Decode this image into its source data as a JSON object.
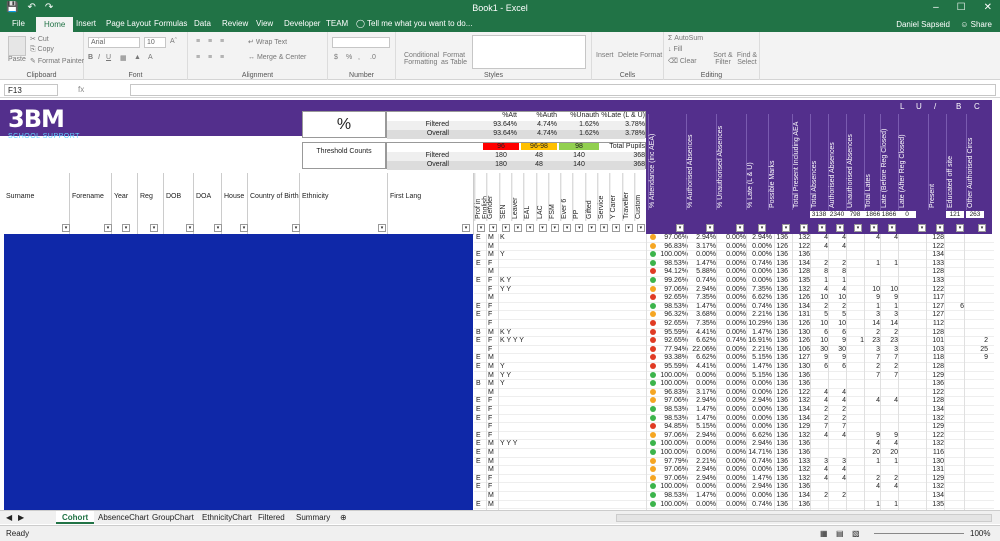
{
  "window": {
    "title": "Book1 - Excel",
    "user": "Daniel Sapseid",
    "share": "Share"
  },
  "tabs": [
    "File",
    "Home",
    "Insert",
    "Page Layout",
    "Formulas",
    "Data",
    "Review",
    "View",
    "Developer",
    "TEAM"
  ],
  "tell_me": "Tell me what you want to do...",
  "ribbon": {
    "clipboard": {
      "label": "Clipboard",
      "paste": "Paste",
      "cut": "Cut",
      "copy": "Copy",
      "format_painter": "Format Painter"
    },
    "font": {
      "label": "Font",
      "name": "Arial",
      "size": "10"
    },
    "alignment": {
      "label": "Alignment",
      "wrap": "Wrap Text",
      "merge": "Merge & Center"
    },
    "number": {
      "label": "Number"
    },
    "styles": {
      "label": "Styles",
      "conditional": "Conditional Formatting",
      "format_as_table": "Format as Table"
    },
    "cells": {
      "label": "Cells",
      "insert": "Insert",
      "delete": "Delete",
      "format": "Format"
    },
    "editing": {
      "label": "Editing",
      "autosum": "AutoSum",
      "fill": "Fill",
      "clear": "Clear",
      "sort": "Sort & Filter",
      "find": "Find & Select"
    }
  },
  "formula_bar": {
    "name_box": "F13",
    "fx": "fx"
  },
  "sheet": {
    "logo_big": "3BM",
    "logo_small": "SCHOOL SUPPORT",
    "pct_symbol": "%",
    "stats_headers": [
      "%Att",
      "%Auth",
      "%Unauth",
      "%Late (L & U)"
    ],
    "stats_filtered_label": "Filtered",
    "stats_overall_label": "Overall",
    "stats_filtered": [
      "93.64%",
      "4.74%",
      "1.62%",
      "3.78%"
    ],
    "stats_overall": [
      "93.64%",
      "4.74%",
      "1.62%",
      "3.78%"
    ],
    "threshold_label": "Threshold Counts",
    "threshold_headers": [
      "96",
      "96-98",
      "98",
      "Total Pupils"
    ],
    "threshold_colors": [
      "#ff0000",
      "#ffc000",
      "#92d050",
      "#ffffff"
    ],
    "threshold_filtered": [
      "180",
      "48",
      "140",
      "368"
    ],
    "threshold_overall": [
      "180",
      "48",
      "140",
      "368"
    ],
    "col_letters": [
      "L",
      "U",
      "/",
      "B",
      "C"
    ],
    "left_headers": [
      "Surname",
      "Forename",
      "Year",
      "Reg",
      "DOB",
      "DOA",
      "House",
      "Country of Birth",
      "Ethnicity",
      "First Lang"
    ],
    "flag_headers": [
      "Prof in English",
      "Gender",
      "SEN",
      "Leaver",
      "EAL",
      "LAC",
      "FSM",
      "Ever 6",
      "PP",
      "Gifted",
      "Service",
      "Y Carer",
      "Traveller",
      "Custom"
    ],
    "metric_headers": [
      "% Attendance (inc AEA)",
      "% Authorised Absences",
      "% Unauthorised Absences",
      "% Late (L & U)",
      "Possible Marks",
      "Total Present Including AEA",
      "Total Absences",
      "Authorised Absences",
      "Unauthorised Absences",
      "Total Lates",
      "Late (Before Reg Closed)",
      "Late (After Reg Closed)",
      "Present",
      "Educated off site",
      "Other Authorised Circs"
    ],
    "totals": {
      "total_absences": "3138",
      "auth": "2340",
      "unauth": "798",
      "total_lates": "1866",
      "late_before": "1866",
      "late_after": "0",
      "edu_off": "121",
      "other_auth": "263"
    },
    "rows": [
      {
        "p": "E",
        "g": "M",
        "f": "K",
        "c": "orange",
        "att": "97.06%",
        "auth": "2.94%",
        "un": "0.00%",
        "late": "2.94%",
        "pm": "136",
        "tp": "132",
        "ta": "4",
        "aa": "4",
        "ua": "",
        "tl": "4",
        "lb": "4",
        "la": "",
        "pr": "128",
        "eo": "",
        "oa": ""
      },
      {
        "p": "",
        "g": "M",
        "f": "",
        "c": "orange",
        "att": "96.83%",
        "auth": "3.17%",
        "un": "0.00%",
        "late": "0.00%",
        "pm": "126",
        "tp": "122",
        "ta": "4",
        "aa": "4",
        "ua": "",
        "tl": "",
        "lb": "",
        "la": "",
        "pr": "122",
        "eo": "",
        "oa": ""
      },
      {
        "p": "E",
        "g": "M",
        "f": "Y",
        "c": "green",
        "att": "100.00%",
        "auth": "0.00%",
        "un": "0.00%",
        "late": "0.00%",
        "pm": "136",
        "tp": "136",
        "ta": "",
        "aa": "",
        "ua": "",
        "tl": "",
        "lb": "",
        "la": "",
        "pr": "134",
        "eo": "",
        "oa": ""
      },
      {
        "p": "E",
        "g": "F",
        "f": "",
        "c": "green",
        "att": "98.53%",
        "auth": "1.47%",
        "un": "0.00%",
        "late": "0.74%",
        "pm": "136",
        "tp": "134",
        "ta": "2",
        "aa": "2",
        "ua": "",
        "tl": "1",
        "lb": "1",
        "la": "",
        "pr": "133",
        "eo": "",
        "oa": ""
      },
      {
        "p": "",
        "g": "M",
        "f": "",
        "c": "red",
        "att": "94.12%",
        "auth": "5.88%",
        "un": "0.00%",
        "late": "0.00%",
        "pm": "136",
        "tp": "128",
        "ta": "8",
        "aa": "8",
        "ua": "",
        "tl": "",
        "lb": "",
        "la": "",
        "pr": "128",
        "eo": "",
        "oa": ""
      },
      {
        "p": "E",
        "g": "F",
        "f": "K Y",
        "c": "green",
        "att": "99.26%",
        "auth": "0.74%",
        "un": "0.00%",
        "late": "0.00%",
        "pm": "136",
        "tp": "135",
        "ta": "1",
        "aa": "1",
        "ua": "",
        "tl": "",
        "lb": "",
        "la": "",
        "pr": "133",
        "eo": "",
        "oa": ""
      },
      {
        "p": "",
        "g": "F",
        "f": "Y Y",
        "c": "orange",
        "att": "97.06%",
        "auth": "2.94%",
        "un": "0.00%",
        "late": "7.35%",
        "pm": "136",
        "tp": "132",
        "ta": "4",
        "aa": "4",
        "ua": "",
        "tl": "10",
        "lb": "10",
        "la": "",
        "pr": "122",
        "eo": "",
        "oa": ""
      },
      {
        "p": "",
        "g": "M",
        "f": "",
        "c": "red",
        "att": "92.65%",
        "auth": "7.35%",
        "un": "0.00%",
        "late": "6.62%",
        "pm": "136",
        "tp": "126",
        "ta": "10",
        "aa": "10",
        "ua": "",
        "tl": "9",
        "lb": "9",
        "la": "",
        "pr": "117",
        "eo": "",
        "oa": ""
      },
      {
        "p": "E",
        "g": "F",
        "f": "",
        "c": "green",
        "att": "98.53%",
        "auth": "1.47%",
        "un": "0.00%",
        "late": "0.74%",
        "pm": "136",
        "tp": "134",
        "ta": "2",
        "aa": "2",
        "ua": "",
        "tl": "1",
        "lb": "1",
        "la": "",
        "pr": "127",
        "eo": "6",
        "oa": ""
      },
      {
        "p": "E",
        "g": "F",
        "f": "",
        "c": "orange",
        "att": "96.32%",
        "auth": "3.68%",
        "un": "0.00%",
        "late": "2.21%",
        "pm": "136",
        "tp": "131",
        "ta": "5",
        "aa": "5",
        "ua": "",
        "tl": "3",
        "lb": "3",
        "la": "",
        "pr": "127",
        "eo": "",
        "oa": ""
      },
      {
        "p": "",
        "g": "F",
        "f": "",
        "c": "red",
        "att": "92.65%",
        "auth": "7.35%",
        "un": "0.00%",
        "late": "10.29%",
        "pm": "136",
        "tp": "126",
        "ta": "10",
        "aa": "10",
        "ua": "",
        "tl": "14",
        "lb": "14",
        "la": "",
        "pr": "112",
        "eo": "",
        "oa": ""
      },
      {
        "p": "B",
        "g": "M",
        "f": "K Y",
        "c": "red",
        "att": "95.59%",
        "auth": "4.41%",
        "un": "0.00%",
        "late": "1.47%",
        "pm": "136",
        "tp": "130",
        "ta": "6",
        "aa": "6",
        "ua": "",
        "tl": "2",
        "lb": "2",
        "la": "",
        "pr": "128",
        "eo": "",
        "oa": ""
      },
      {
        "p": "E",
        "g": "F",
        "f": "K Y Y Y",
        "c": "red",
        "att": "92.65%",
        "auth": "6.62%",
        "un": "0.74%",
        "late": "16.91%",
        "pm": "136",
        "tp": "126",
        "ta": "10",
        "aa": "9",
        "ua": "1",
        "tl": "23",
        "lb": "23",
        "la": "",
        "pr": "101",
        "eo": "",
        "oa": "2"
      },
      {
        "p": "",
        "g": "F",
        "f": "",
        "c": "red",
        "att": "77.94%",
        "auth": "22.06%",
        "un": "0.00%",
        "late": "2.21%",
        "pm": "136",
        "tp": "106",
        "ta": "30",
        "aa": "30",
        "ua": "",
        "tl": "3",
        "lb": "3",
        "la": "",
        "pr": "103",
        "eo": "",
        "oa": "25"
      },
      {
        "p": "E",
        "g": "M",
        "f": "",
        "c": "red",
        "att": "93.38%",
        "auth": "6.62%",
        "un": "0.00%",
        "late": "5.15%",
        "pm": "136",
        "tp": "127",
        "ta": "9",
        "aa": "9",
        "ua": "",
        "tl": "7",
        "lb": "7",
        "la": "",
        "pr": "118",
        "eo": "",
        "oa": "9"
      },
      {
        "p": "E",
        "g": "M",
        "f": "Y",
        "c": "red",
        "att": "95.59%",
        "auth": "4.41%",
        "un": "0.00%",
        "late": "1.47%",
        "pm": "136",
        "tp": "130",
        "ta": "6",
        "aa": "6",
        "ua": "",
        "tl": "2",
        "lb": "2",
        "la": "",
        "pr": "128",
        "eo": "",
        "oa": ""
      },
      {
        "p": "",
        "g": "M",
        "f": "Y Y",
        "c": "green",
        "att": "100.00%",
        "auth": "0.00%",
        "un": "0.00%",
        "late": "5.15%",
        "pm": "136",
        "tp": "136",
        "ta": "",
        "aa": "",
        "ua": "",
        "tl": "7",
        "lb": "7",
        "la": "",
        "pr": "129",
        "eo": "",
        "oa": ""
      },
      {
        "p": "B",
        "g": "M",
        "f": "Y",
        "c": "green",
        "att": "100.00%",
        "auth": "0.00%",
        "un": "0.00%",
        "late": "0.00%",
        "pm": "136",
        "tp": "136",
        "ta": "",
        "aa": "",
        "ua": "",
        "tl": "",
        "lb": "",
        "la": "",
        "pr": "136",
        "eo": "",
        "oa": ""
      },
      {
        "p": "",
        "g": "M",
        "f": "",
        "c": "orange",
        "att": "96.83%",
        "auth": "3.17%",
        "un": "0.00%",
        "late": "0.00%",
        "pm": "126",
        "tp": "122",
        "ta": "4",
        "aa": "4",
        "ua": "",
        "tl": "",
        "lb": "",
        "la": "",
        "pr": "122",
        "eo": "",
        "oa": ""
      },
      {
        "p": "E",
        "g": "F",
        "f": "",
        "c": "orange",
        "att": "97.06%",
        "auth": "2.94%",
        "un": "0.00%",
        "late": "2.94%",
        "pm": "136",
        "tp": "132",
        "ta": "4",
        "aa": "4",
        "ua": "",
        "tl": "4",
        "lb": "4",
        "la": "",
        "pr": "128",
        "eo": "",
        "oa": ""
      },
      {
        "p": "E",
        "g": "F",
        "f": "",
        "c": "green",
        "att": "98.53%",
        "auth": "1.47%",
        "un": "0.00%",
        "late": "0.00%",
        "pm": "136",
        "tp": "134",
        "ta": "2",
        "aa": "2",
        "ua": "",
        "tl": "",
        "lb": "",
        "la": "",
        "pr": "134",
        "eo": "",
        "oa": ""
      },
      {
        "p": "E",
        "g": "F",
        "f": "",
        "c": "green",
        "att": "98.53%",
        "auth": "1.47%",
        "un": "0.00%",
        "late": "0.00%",
        "pm": "136",
        "tp": "134",
        "ta": "2",
        "aa": "2",
        "ua": "",
        "tl": "",
        "lb": "",
        "la": "",
        "pr": "132",
        "eo": "",
        "oa": ""
      },
      {
        "p": "",
        "g": "F",
        "f": "",
        "c": "red",
        "att": "94.85%",
        "auth": "5.15%",
        "un": "0.00%",
        "late": "0.00%",
        "pm": "136",
        "tp": "129",
        "ta": "7",
        "aa": "7",
        "ua": "",
        "tl": "",
        "lb": "",
        "la": "",
        "pr": "129",
        "eo": "",
        "oa": ""
      },
      {
        "p": "E",
        "g": "F",
        "f": "",
        "c": "orange",
        "att": "97.06%",
        "auth": "2.94%",
        "un": "0.00%",
        "late": "6.62%",
        "pm": "136",
        "tp": "132",
        "ta": "4",
        "aa": "4",
        "ua": "",
        "tl": "9",
        "lb": "9",
        "la": "",
        "pr": "122",
        "eo": "",
        "oa": ""
      },
      {
        "p": "E",
        "g": "M",
        "f": "Y Y Y",
        "c": "green",
        "att": "100.00%",
        "auth": "0.00%",
        "un": "0.00%",
        "late": "2.94%",
        "pm": "136",
        "tp": "136",
        "ta": "",
        "aa": "",
        "ua": "",
        "tl": "4",
        "lb": "4",
        "la": "",
        "pr": "132",
        "eo": "",
        "oa": ""
      },
      {
        "p": "E",
        "g": "M",
        "f": "",
        "c": "green",
        "att": "100.00%",
        "auth": "0.00%",
        "un": "0.00%",
        "late": "14.71%",
        "pm": "136",
        "tp": "136",
        "ta": "",
        "aa": "",
        "ua": "",
        "tl": "20",
        "lb": "20",
        "la": "",
        "pr": "116",
        "eo": "",
        "oa": ""
      },
      {
        "p": "E",
        "g": "M",
        "f": "",
        "c": "orange",
        "att": "97.79%",
        "auth": "2.21%",
        "un": "0.00%",
        "late": "0.74%",
        "pm": "136",
        "tp": "133",
        "ta": "3",
        "aa": "3",
        "ua": "",
        "tl": "1",
        "lb": "1",
        "la": "",
        "pr": "130",
        "eo": "",
        "oa": ""
      },
      {
        "p": "",
        "g": "M",
        "f": "",
        "c": "orange",
        "att": "97.06%",
        "auth": "2.94%",
        "un": "0.00%",
        "late": "0.00%",
        "pm": "136",
        "tp": "132",
        "ta": "4",
        "aa": "4",
        "ua": "",
        "tl": "",
        "lb": "",
        "la": "",
        "pr": "131",
        "eo": "",
        "oa": ""
      },
      {
        "p": "E",
        "g": "F",
        "f": "",
        "c": "orange",
        "att": "97.06%",
        "auth": "2.94%",
        "un": "0.00%",
        "late": "1.47%",
        "pm": "136",
        "tp": "132",
        "ta": "4",
        "aa": "4",
        "ua": "",
        "tl": "2",
        "lb": "2",
        "la": "",
        "pr": "129",
        "eo": "",
        "oa": ""
      },
      {
        "p": "E",
        "g": "F",
        "f": "",
        "c": "green",
        "att": "100.00%",
        "auth": "0.00%",
        "un": "0.00%",
        "late": "2.94%",
        "pm": "136",
        "tp": "136",
        "ta": "",
        "aa": "",
        "ua": "",
        "tl": "4",
        "lb": "4",
        "la": "",
        "pr": "132",
        "eo": "",
        "oa": ""
      },
      {
        "p": "",
        "g": "M",
        "f": "",
        "c": "green",
        "att": "98.53%",
        "auth": "1.47%",
        "un": "0.00%",
        "late": "0.00%",
        "pm": "136",
        "tp": "134",
        "ta": "2",
        "aa": "2",
        "ua": "",
        "tl": "",
        "lb": "",
        "la": "",
        "pr": "134",
        "eo": "",
        "oa": ""
      },
      {
        "p": "E",
        "g": "M",
        "f": "",
        "c": "green",
        "att": "100.00%",
        "auth": "0.00%",
        "un": "0.00%",
        "late": "0.74%",
        "pm": "136",
        "tp": "136",
        "ta": "",
        "aa": "",
        "ua": "",
        "tl": "1",
        "lb": "1",
        "la": "",
        "pr": "135",
        "eo": "",
        "oa": ""
      }
    ]
  },
  "sheet_tabs": [
    "Cohort",
    "AbsenceChart",
    "GroupChart",
    "EthnicityChart",
    "Filtered",
    "Summary"
  ],
  "status": {
    "ready": "Ready",
    "zoom": "100%"
  },
  "colors": {
    "excel_green": "#217346",
    "header_purple": "#532f8c",
    "redaction_blue": "#0f28a8",
    "red": "#e03b24",
    "orange": "#f5a623",
    "green": "#3cb44b"
  }
}
